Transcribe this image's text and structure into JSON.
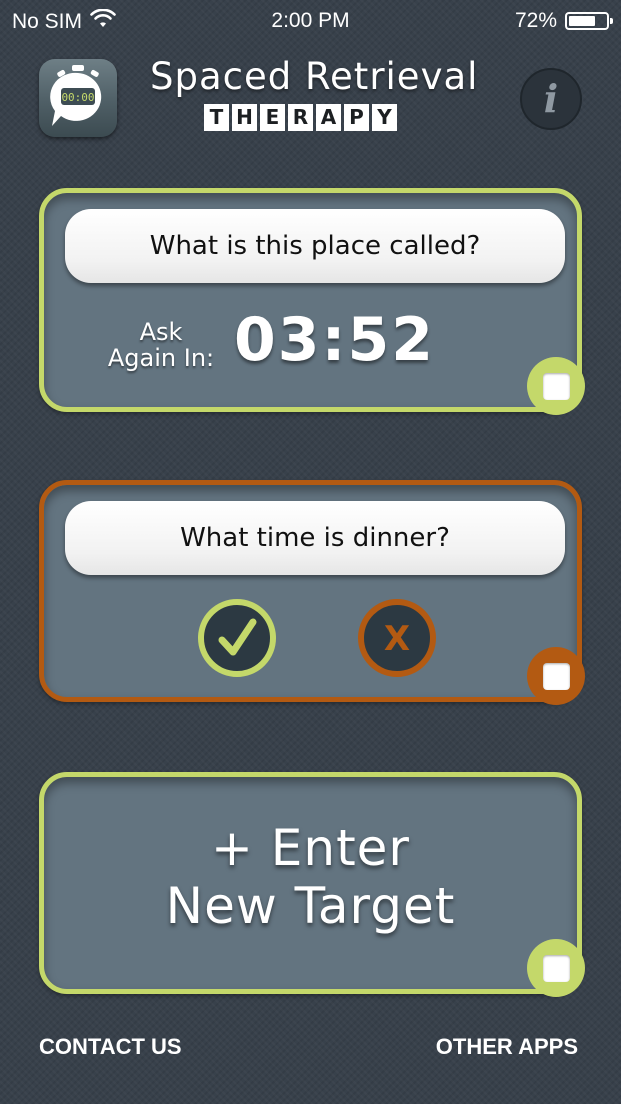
{
  "status_bar": {
    "carrier": "No SIM",
    "time": "2:00 PM",
    "battery": "72%",
    "battery_level": 0.72
  },
  "header": {
    "icon_time": "00:00",
    "title": "Spaced Retrieval",
    "subtitle_letters": [
      "T",
      "H",
      "E",
      "R",
      "A",
      "P",
      "Y"
    ],
    "info_label": "i"
  },
  "cards": [
    {
      "question": "What is this place called?",
      "ask_label_line1": "Ask",
      "ask_label_line2": "Again In:",
      "timer": "03:52",
      "accent": "#c4d86a"
    },
    {
      "question": "What time is dinner?",
      "correct_label": "✓",
      "wrong_label": "X",
      "accent": "#b35a12"
    },
    {
      "action_line1": "+ Enter",
      "action_line2": "New Target",
      "accent": "#c4d86a"
    }
  ],
  "footer": {
    "contact": "CONTACT US",
    "other_apps": "OTHER APPS"
  }
}
